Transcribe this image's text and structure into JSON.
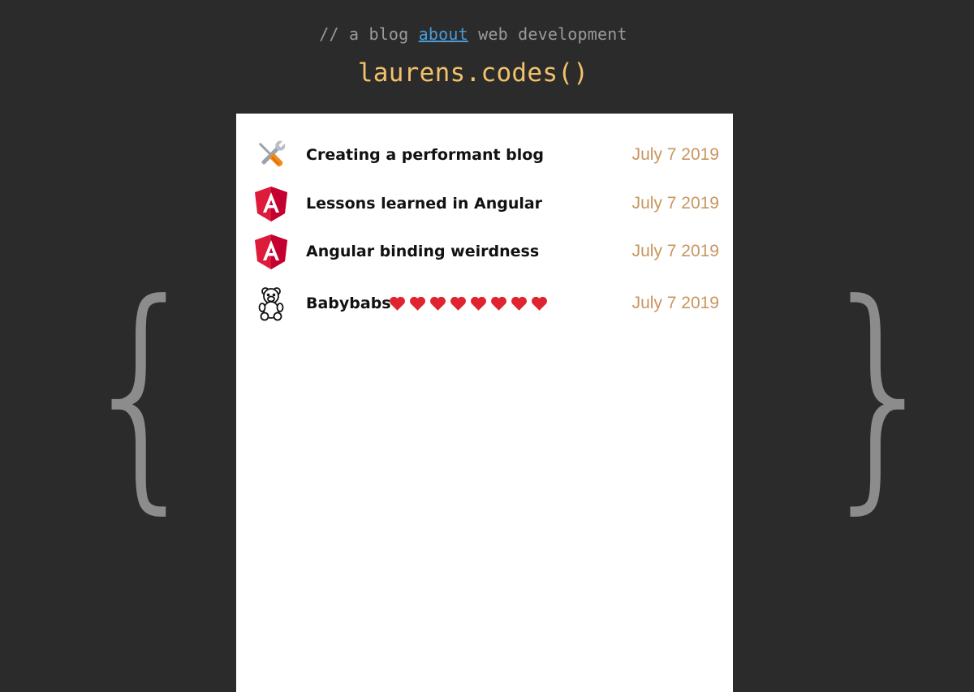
{
  "header": {
    "tagline_prefix": "// a blog ",
    "tagline_link": "about",
    "tagline_suffix": " web development",
    "site_title": "laurens.codes()"
  },
  "decor": {
    "left_brace": "{",
    "right_brace": "}"
  },
  "posts": [
    {
      "title": "Creating a performant blog",
      "date": "July 7 2019",
      "icon": "tools-icon"
    },
    {
      "title": "Lessons learned in Angular",
      "date": "July 7 2019",
      "icon": "angular-logo-icon"
    },
    {
      "title": "Angular binding weirdness",
      "date": "July 7 2019",
      "icon": "angular-logo-icon"
    },
    {
      "title": "Babybabs",
      "date": "July 7 2019",
      "icon": "teddy-bear-icon",
      "hearts": 8
    }
  ],
  "colors": {
    "background": "#2b2b2b",
    "title": "#f2c16c",
    "link": "#4a9bd8",
    "date": "#c8955f",
    "heart": "#e0242f",
    "angular": "#dd1b3a"
  }
}
